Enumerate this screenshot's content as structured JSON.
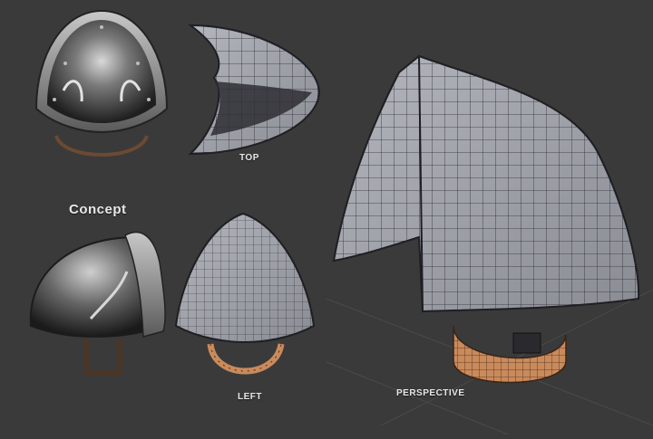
{
  "labels": {
    "top": "TOP",
    "concept": "Concept",
    "left": "LEFT",
    "perspective": "PERSPECTIVE"
  },
  "colors": {
    "background": "#3a3a3a",
    "metal_dark": "#2b2b2b",
    "metal_light": "#b9b9b9",
    "wire_shell": "#9ea0a8",
    "wire_line": "#2a2a30",
    "strap": "#c98a5c"
  }
}
